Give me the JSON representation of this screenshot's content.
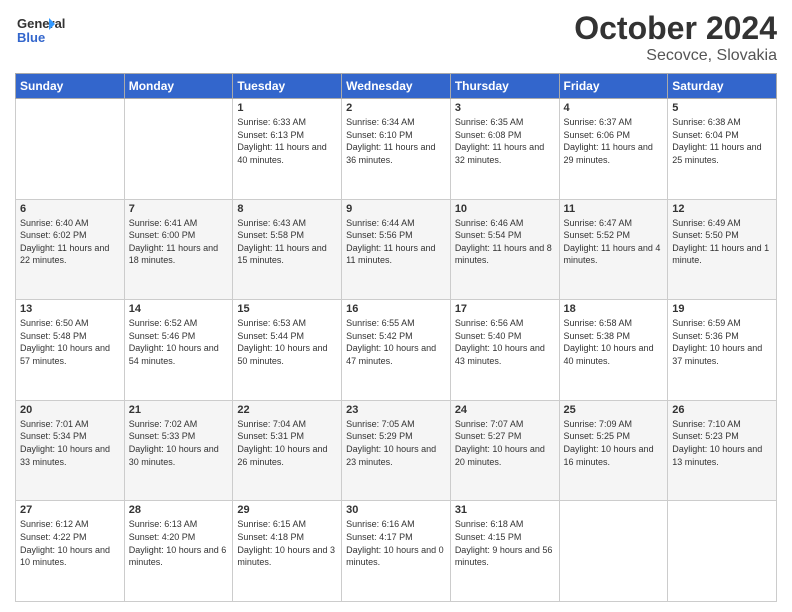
{
  "logo": {
    "line1": "General",
    "line2": "Blue"
  },
  "title": "October 2024",
  "location": "Secovce, Slovakia",
  "weekdays": [
    "Sunday",
    "Monday",
    "Tuesday",
    "Wednesday",
    "Thursday",
    "Friday",
    "Saturday"
  ],
  "weeks": [
    [
      {
        "day": "",
        "info": ""
      },
      {
        "day": "",
        "info": ""
      },
      {
        "day": "1",
        "info": "Sunrise: 6:33 AM\nSunset: 6:13 PM\nDaylight: 11 hours and 40 minutes."
      },
      {
        "day": "2",
        "info": "Sunrise: 6:34 AM\nSunset: 6:10 PM\nDaylight: 11 hours and 36 minutes."
      },
      {
        "day": "3",
        "info": "Sunrise: 6:35 AM\nSunset: 6:08 PM\nDaylight: 11 hours and 32 minutes."
      },
      {
        "day": "4",
        "info": "Sunrise: 6:37 AM\nSunset: 6:06 PM\nDaylight: 11 hours and 29 minutes."
      },
      {
        "day": "5",
        "info": "Sunrise: 6:38 AM\nSunset: 6:04 PM\nDaylight: 11 hours and 25 minutes."
      }
    ],
    [
      {
        "day": "6",
        "info": "Sunrise: 6:40 AM\nSunset: 6:02 PM\nDaylight: 11 hours and 22 minutes."
      },
      {
        "day": "7",
        "info": "Sunrise: 6:41 AM\nSunset: 6:00 PM\nDaylight: 11 hours and 18 minutes."
      },
      {
        "day": "8",
        "info": "Sunrise: 6:43 AM\nSunset: 5:58 PM\nDaylight: 11 hours and 15 minutes."
      },
      {
        "day": "9",
        "info": "Sunrise: 6:44 AM\nSunset: 5:56 PM\nDaylight: 11 hours and 11 minutes."
      },
      {
        "day": "10",
        "info": "Sunrise: 6:46 AM\nSunset: 5:54 PM\nDaylight: 11 hours and 8 minutes."
      },
      {
        "day": "11",
        "info": "Sunrise: 6:47 AM\nSunset: 5:52 PM\nDaylight: 11 hours and 4 minutes."
      },
      {
        "day": "12",
        "info": "Sunrise: 6:49 AM\nSunset: 5:50 PM\nDaylight: 11 hours and 1 minute."
      }
    ],
    [
      {
        "day": "13",
        "info": "Sunrise: 6:50 AM\nSunset: 5:48 PM\nDaylight: 10 hours and 57 minutes."
      },
      {
        "day": "14",
        "info": "Sunrise: 6:52 AM\nSunset: 5:46 PM\nDaylight: 10 hours and 54 minutes."
      },
      {
        "day": "15",
        "info": "Sunrise: 6:53 AM\nSunset: 5:44 PM\nDaylight: 10 hours and 50 minutes."
      },
      {
        "day": "16",
        "info": "Sunrise: 6:55 AM\nSunset: 5:42 PM\nDaylight: 10 hours and 47 minutes."
      },
      {
        "day": "17",
        "info": "Sunrise: 6:56 AM\nSunset: 5:40 PM\nDaylight: 10 hours and 43 minutes."
      },
      {
        "day": "18",
        "info": "Sunrise: 6:58 AM\nSunset: 5:38 PM\nDaylight: 10 hours and 40 minutes."
      },
      {
        "day": "19",
        "info": "Sunrise: 6:59 AM\nSunset: 5:36 PM\nDaylight: 10 hours and 37 minutes."
      }
    ],
    [
      {
        "day": "20",
        "info": "Sunrise: 7:01 AM\nSunset: 5:34 PM\nDaylight: 10 hours and 33 minutes."
      },
      {
        "day": "21",
        "info": "Sunrise: 7:02 AM\nSunset: 5:33 PM\nDaylight: 10 hours and 30 minutes."
      },
      {
        "day": "22",
        "info": "Sunrise: 7:04 AM\nSunset: 5:31 PM\nDaylight: 10 hours and 26 minutes."
      },
      {
        "day": "23",
        "info": "Sunrise: 7:05 AM\nSunset: 5:29 PM\nDaylight: 10 hours and 23 minutes."
      },
      {
        "day": "24",
        "info": "Sunrise: 7:07 AM\nSunset: 5:27 PM\nDaylight: 10 hours and 20 minutes."
      },
      {
        "day": "25",
        "info": "Sunrise: 7:09 AM\nSunset: 5:25 PM\nDaylight: 10 hours and 16 minutes."
      },
      {
        "day": "26",
        "info": "Sunrise: 7:10 AM\nSunset: 5:23 PM\nDaylight: 10 hours and 13 minutes."
      }
    ],
    [
      {
        "day": "27",
        "info": "Sunrise: 6:12 AM\nSunset: 4:22 PM\nDaylight: 10 hours and 10 minutes."
      },
      {
        "day": "28",
        "info": "Sunrise: 6:13 AM\nSunset: 4:20 PM\nDaylight: 10 hours and 6 minutes."
      },
      {
        "day": "29",
        "info": "Sunrise: 6:15 AM\nSunset: 4:18 PM\nDaylight: 10 hours and 3 minutes."
      },
      {
        "day": "30",
        "info": "Sunrise: 6:16 AM\nSunset: 4:17 PM\nDaylight: 10 hours and 0 minutes."
      },
      {
        "day": "31",
        "info": "Sunrise: 6:18 AM\nSunset: 4:15 PM\nDaylight: 9 hours and 56 minutes."
      },
      {
        "day": "",
        "info": ""
      },
      {
        "day": "",
        "info": ""
      }
    ]
  ]
}
